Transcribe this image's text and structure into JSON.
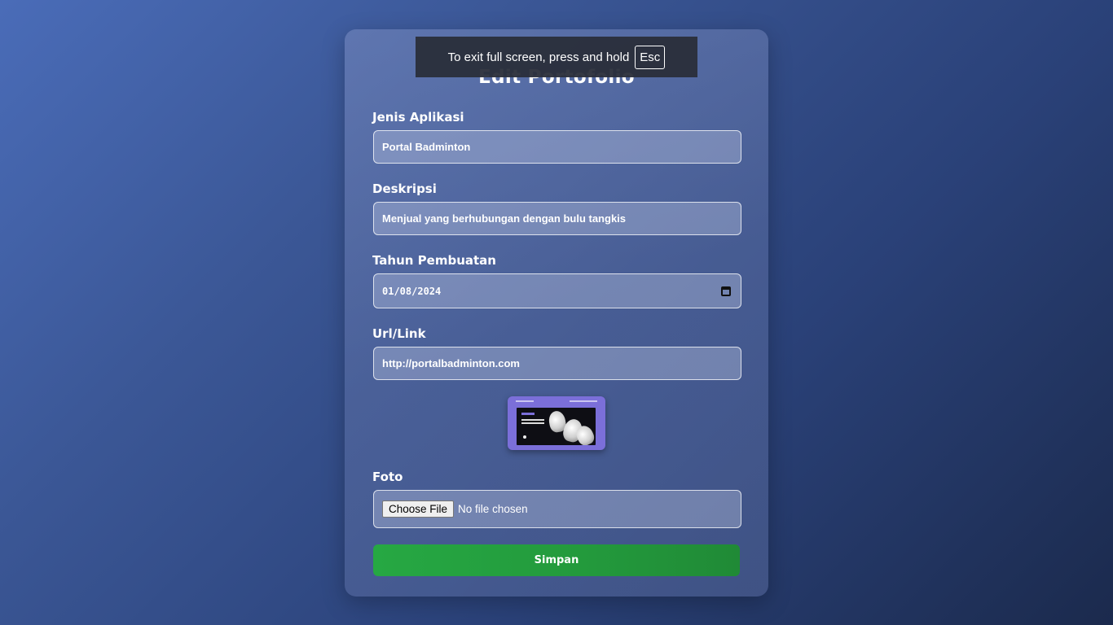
{
  "page": {
    "title": "Edit Portofolio"
  },
  "form": {
    "jenis_aplikasi": {
      "label": "Jenis Aplikasi",
      "value": "Portal Badminton"
    },
    "deskripsi": {
      "label": "Deskripsi",
      "value": "Menjual yang berhubungan dengan bulu tangkis"
    },
    "tahun_pembuatan": {
      "label": "Tahun Pembuatan",
      "value": "01/08/2024"
    },
    "url": {
      "label": "Url/Link",
      "value": "http://portalbadminton.com"
    },
    "foto": {
      "label": "Foto",
      "choose_label": "Choose File",
      "status": "No file chosen"
    },
    "submit_label": "Simpan"
  },
  "fullscreen_notice": {
    "text": "To exit full screen, press and hold",
    "key": "Esc"
  },
  "colors": {
    "submit": "#26a843",
    "banner": "#2a2e3a",
    "thumbnail_bg": "#7b6fd9"
  },
  "icons": {
    "date_picker": "calendar-icon"
  }
}
